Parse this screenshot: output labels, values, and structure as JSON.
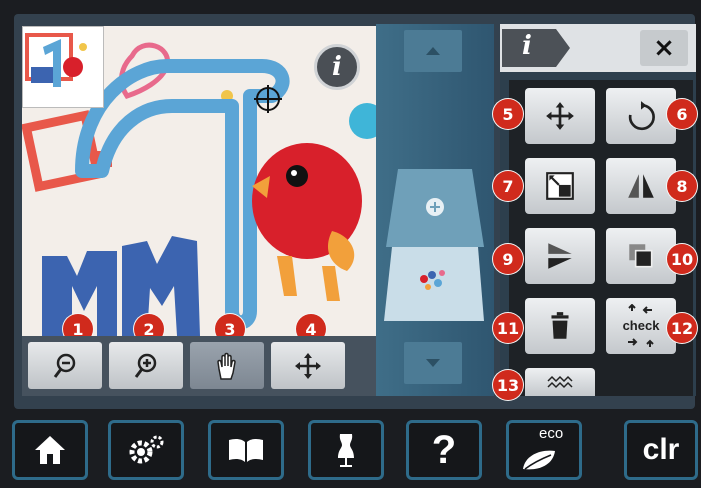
{
  "zoom_toolbar": {
    "zoom_out_badge": "1",
    "zoom_in_badge": "2",
    "hand_badge": "3",
    "move_view_badge": "4"
  },
  "canvas": {
    "info_label": "i"
  },
  "info_header": {
    "tab_label": "i",
    "close_label": "×"
  },
  "tools": {
    "move_badge": "5",
    "rotate_badge": "6",
    "resize_badge": "7",
    "mirror_lr_badge": "8",
    "mirror_ud_badge": "9",
    "duplicate_badge": "10",
    "delete_badge": "11",
    "check_badge": "12",
    "check_label": "check",
    "stitch_badge": "13"
  },
  "bottom_bar": {
    "help_label": "?",
    "eco_label": "eco",
    "clr_label": "clr"
  },
  "colors": {
    "badge": "#d02a1c",
    "accent_blue": "#2e6b8a",
    "canvas_bg": "#f3eee9"
  }
}
